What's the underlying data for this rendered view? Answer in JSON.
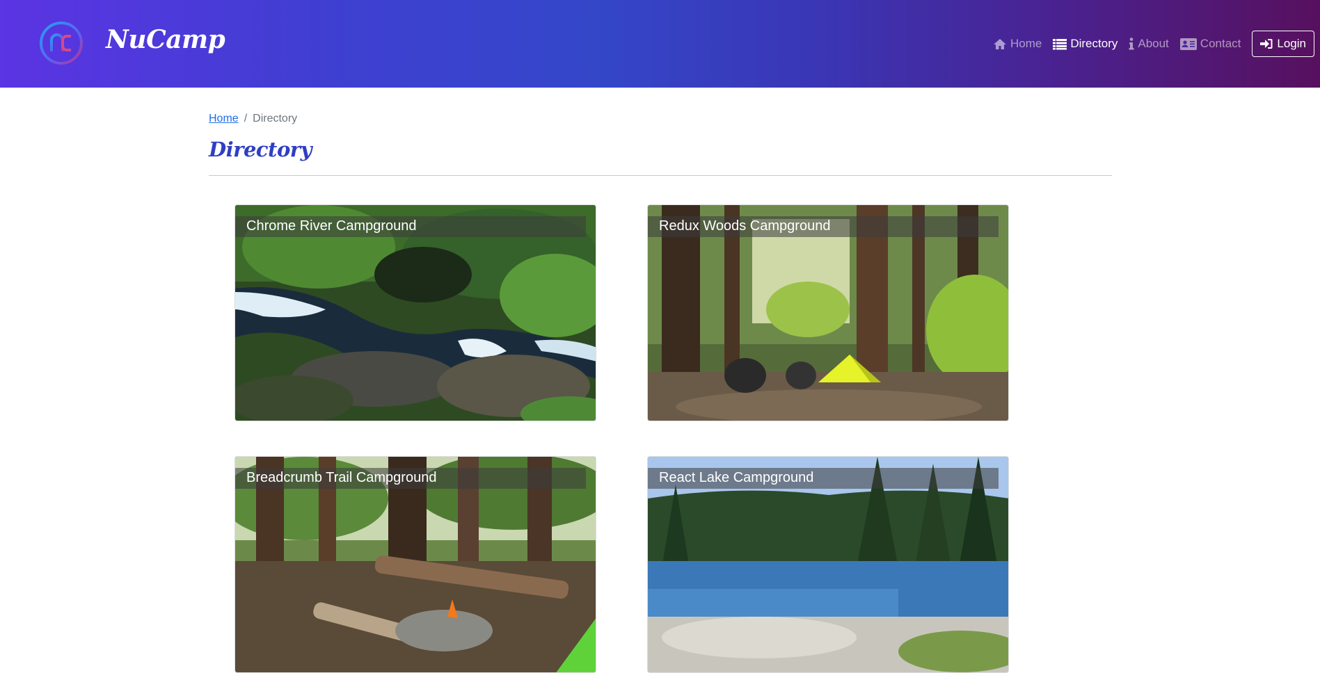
{
  "header": {
    "brand": "NuCamp",
    "nav": [
      {
        "label": "Home",
        "icon": "home-icon",
        "active": false
      },
      {
        "label": "Directory",
        "icon": "list-icon",
        "active": true
      },
      {
        "label": "About",
        "icon": "info-icon",
        "active": false
      },
      {
        "label": "Contact",
        "icon": "address-card-icon",
        "active": false
      }
    ],
    "login_label": "Login"
  },
  "breadcrumb": {
    "home": "Home",
    "separator": "/",
    "current": "Directory"
  },
  "page_title": "Directory",
  "campsites": [
    {
      "name": "Chrome River Campground"
    },
    {
      "name": "Redux Woods Campground"
    },
    {
      "name": "Breadcrumb Trail Campground"
    },
    {
      "name": "React Lake Campground"
    }
  ],
  "colors": {
    "header_gradient_start": "#5b34e3",
    "header_gradient_end": "#57105e",
    "title": "#2f3fc4",
    "link": "#1f6ee8"
  }
}
